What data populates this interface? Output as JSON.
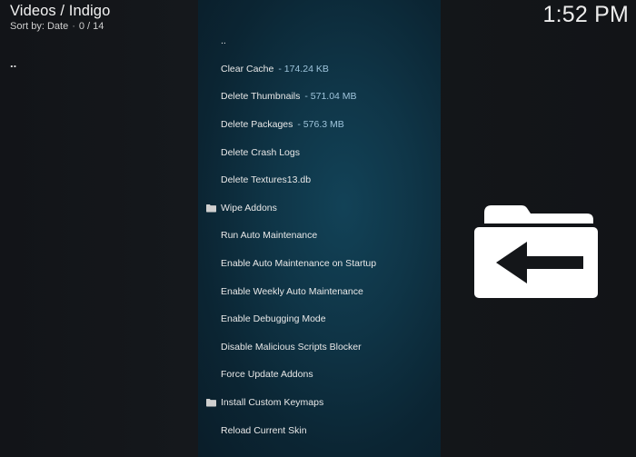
{
  "header": {
    "title": "Videos / Indigo",
    "sort_label": "Sort by: Date",
    "separator": "·",
    "count": "0 / 14"
  },
  "clock": "1:52 PM",
  "left_pane": {
    "parent_label": ".."
  },
  "list": {
    "items": [
      {
        "label": "..",
        "size": "",
        "icon": ""
      },
      {
        "label": "Clear Cache",
        "size": "- 174.24 KB",
        "icon": ""
      },
      {
        "label": "Delete Thumbnails",
        "size": "- 571.04 MB",
        "icon": ""
      },
      {
        "label": "Delete Packages",
        "size": "- 576.3 MB",
        "icon": ""
      },
      {
        "label": "Delete Crash Logs",
        "size": "",
        "icon": ""
      },
      {
        "label": "Delete Textures13.db",
        "size": "",
        "icon": ""
      },
      {
        "label": "Wipe Addons",
        "size": "",
        "icon": "folder-icon"
      },
      {
        "label": "Run Auto Maintenance",
        "size": "",
        "icon": ""
      },
      {
        "label": "Enable Auto Maintenance on Startup",
        "size": "",
        "icon": ""
      },
      {
        "label": "Enable Weekly Auto Maintenance",
        "size": "",
        "icon": ""
      },
      {
        "label": "Enable Debugging Mode",
        "size": "",
        "icon": ""
      },
      {
        "label": "Disable Malicious Scripts Blocker",
        "size": "",
        "icon": ""
      },
      {
        "label": "Force Update Addons",
        "size": "",
        "icon": ""
      },
      {
        "label": "Install Custom Keymaps",
        "size": "",
        "icon": "folder-icon"
      },
      {
        "label": "Reload Current Skin",
        "size": "",
        "icon": ""
      }
    ]
  },
  "preview_icon": "folder-back-icon",
  "colors": {
    "panel": "#0f3547",
    "size_text": "#9ec4db",
    "background": "#121418"
  }
}
